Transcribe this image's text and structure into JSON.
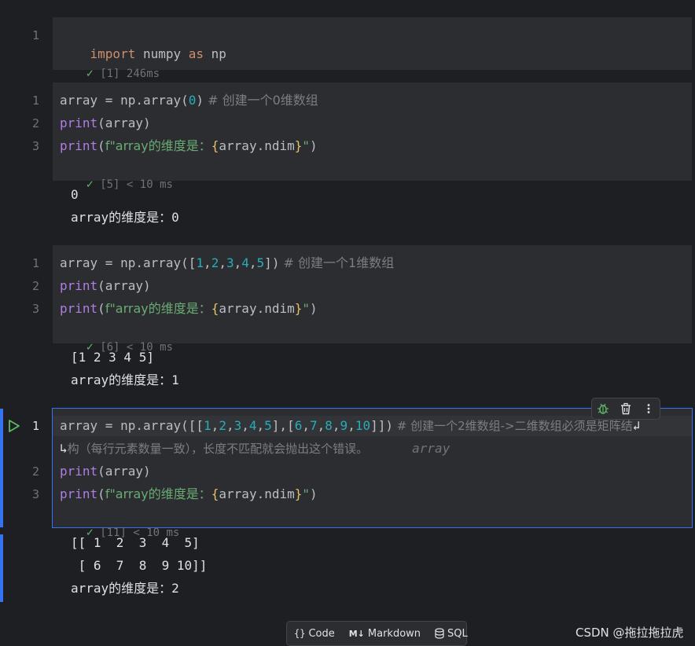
{
  "cells": [
    {
      "id": "cell1",
      "lines": [
        {
          "num": "1"
        }
      ],
      "code": {
        "kw_import": "import",
        "module": " numpy ",
        "kw_as": "as",
        "alias": " np"
      },
      "status": {
        "exec": "[1]",
        "time": "246ms"
      }
    },
    {
      "id": "cell2",
      "lines": [
        {
          "num": "1"
        },
        {
          "num": "2"
        },
        {
          "num": "3"
        }
      ],
      "status": {
        "exec": "[5]",
        "time": "< 10 ms"
      },
      "output": [
        "0",
        "array的维度是：0"
      ]
    },
    {
      "id": "cell3",
      "lines": [
        {
          "num": "1"
        },
        {
          "num": "2"
        },
        {
          "num": "3"
        }
      ],
      "status": {
        "exec": "[6]",
        "time": "< 10 ms"
      },
      "output": [
        "[1 2 3 4 5]",
        "array的维度是：1"
      ]
    },
    {
      "id": "cell4",
      "lines": [
        {
          "num": "1"
        },
        {
          "num": "2"
        },
        {
          "num": "3"
        }
      ],
      "status": {
        "exec": "[11]",
        "time": "< 10 ms"
      },
      "output": [
        "[[ 1  2  3  4  5]",
        " [ 6  7  8  9 10]]",
        "array的维度是：2"
      ]
    }
  ],
  "code_text": {
    "array_assign": "array = np.array(",
    "zero": "0",
    "close": ")",
    "comment0": " # 创建一个0维数组",
    "comment1": " # 创建一个1维数组",
    "comment2a": " # 创建一个2维数组->二维数组必须是矩阵结",
    "comment2b": "构（每行元素数量一致），长度不匹配就会抛出这个错误。",
    "inline_hint": "array",
    "print_fn": "print",
    "print_arg": "(array)",
    "fstring_prefix": "f\"array的维度是：",
    "fstring_open": "{",
    "fstring_expr": "array.ndim",
    "fstring_close": "}",
    "fstring_end": "\"",
    "paren_close": ")"
  },
  "toolbar": {
    "icons": [
      "bug-icon",
      "trash-icon",
      "more-icon"
    ]
  },
  "bottom_bar": {
    "code_label": "Code",
    "markdown_label": "Markdown",
    "sql_label": "SQL"
  },
  "watermark": "CSDN @拖拉拖拉虎",
  "colors": {
    "accent": "#3574f0",
    "success": "#5fb865",
    "keyword": "#cf8e6d",
    "function": "#b07de3",
    "number": "#2aacb8",
    "string": "#6aab73",
    "comment": "#7a7e85"
  }
}
